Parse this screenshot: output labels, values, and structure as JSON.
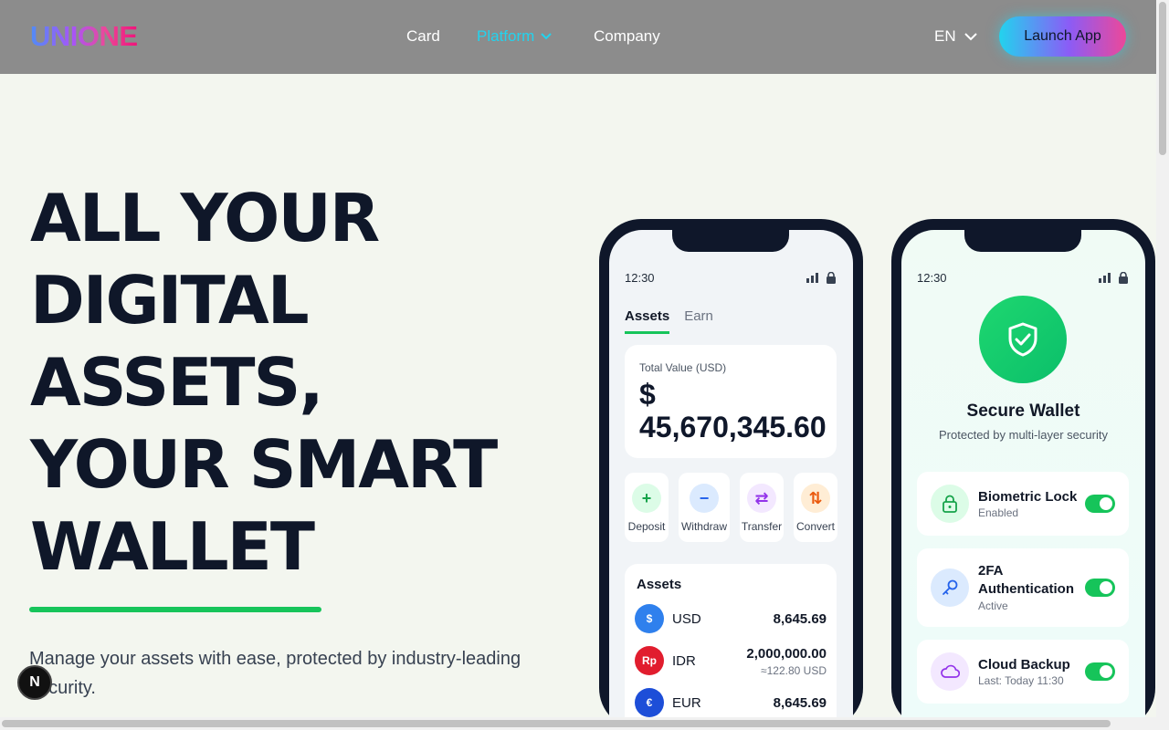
{
  "header": {
    "logo": "UNIONE",
    "nav": [
      {
        "label": "Card"
      },
      {
        "label": "Platform"
      },
      {
        "label": "Company"
      }
    ],
    "language": "EN",
    "launch_label": "Launch App"
  },
  "hero": {
    "title_lines": [
      "ALL YOUR",
      "DIGITAL",
      "ASSETS,",
      "YOUR SMART",
      "WALLET"
    ],
    "subtitle": "Manage your assets with ease, protected by industry-leading security.",
    "badge": "N"
  },
  "phone1": {
    "time": "12:30",
    "tabs": [
      "Assets",
      "Earn"
    ],
    "total_label": "Total Value (USD)",
    "total_value": "$\n45,670,345.60",
    "actions": [
      {
        "label": "Deposit",
        "glyph": "+",
        "color": "#16a34a",
        "bg": "#dcfce7"
      },
      {
        "label": "Withdraw",
        "glyph": "−",
        "color": "#2563eb",
        "bg": "#dbeafe"
      },
      {
        "label": "Transfer",
        "glyph": "⇄",
        "color": "#9333ea",
        "bg": "#f3e8ff"
      },
      {
        "label": "Convert",
        "glyph": "⇅",
        "color": "#ea580c",
        "bg": "#ffedd5"
      }
    ],
    "assets_title": "Assets",
    "assets": [
      {
        "symbol": "USD",
        "coin": "$",
        "color": "#2f80ed",
        "amount": "8,645.69",
        "sub": ""
      },
      {
        "symbol": "IDR",
        "coin": "Rp",
        "color": "#e11d2e",
        "amount": "2,000,000.00",
        "sub": "≈122.80 USD"
      },
      {
        "symbol": "EUR",
        "coin": "€",
        "color": "#1d4ed8",
        "amount": "8,645.69",
        "sub": ""
      }
    ]
  },
  "phone2": {
    "time": "12:30",
    "title": "Secure Wallet",
    "subtitle": "Protected by multi-layer security",
    "items": [
      {
        "name": "Biometric Lock",
        "state": "Enabled",
        "icon": "lock-icon",
        "color": "#16a34a",
        "bg": "#dcfce7",
        "on": true
      },
      {
        "name": "2FA Authentication",
        "state": "Active",
        "icon": "key-icon",
        "color": "#2563eb",
        "bg": "#dbeafe",
        "on": true
      },
      {
        "name": "Cloud Backup",
        "state": "Last: Today 11:30",
        "icon": "cloud-icon",
        "color": "#9333ea",
        "bg": "#f3e8ff",
        "on": true
      }
    ]
  }
}
